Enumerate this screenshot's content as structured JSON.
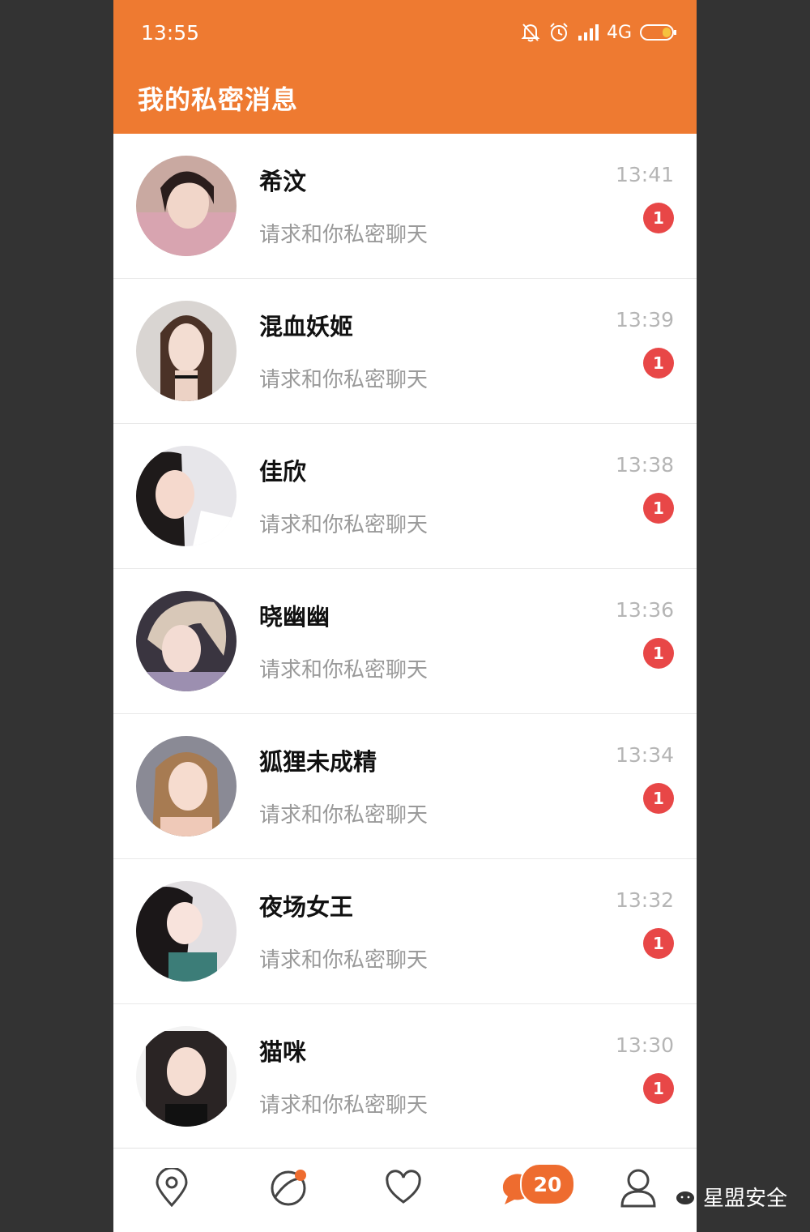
{
  "status_bar": {
    "time": "13:55",
    "network": "4G"
  },
  "header": {
    "title": "我的私密消息"
  },
  "conversations": [
    {
      "name": "希汶",
      "message": "请求和你私密聊天",
      "time": "13:41",
      "unread": "1"
    },
    {
      "name": "混血妖姬",
      "message": "请求和你私密聊天",
      "time": "13:39",
      "unread": "1"
    },
    {
      "name": "佳欣",
      "message": "请求和你私密聊天",
      "time": "13:38",
      "unread": "1"
    },
    {
      "name": "晓幽幽",
      "message": "请求和你私密聊天",
      "time": "13:36",
      "unread": "1"
    },
    {
      "name": "狐狸未成精",
      "message": "请求和你私密聊天",
      "time": "13:34",
      "unread": "1"
    },
    {
      "name": "夜场女王",
      "message": "请求和你私密聊天",
      "time": "13:32",
      "unread": "1"
    },
    {
      "name": "猫咪",
      "message": "请求和你私密聊天",
      "time": "13:30",
      "unread": "1"
    }
  ],
  "tab_bar": {
    "messages_badge": "20"
  },
  "watermark": {
    "text": "星盟安全"
  },
  "colors": {
    "accent": "#ee7a31",
    "badge": "#e84747"
  }
}
